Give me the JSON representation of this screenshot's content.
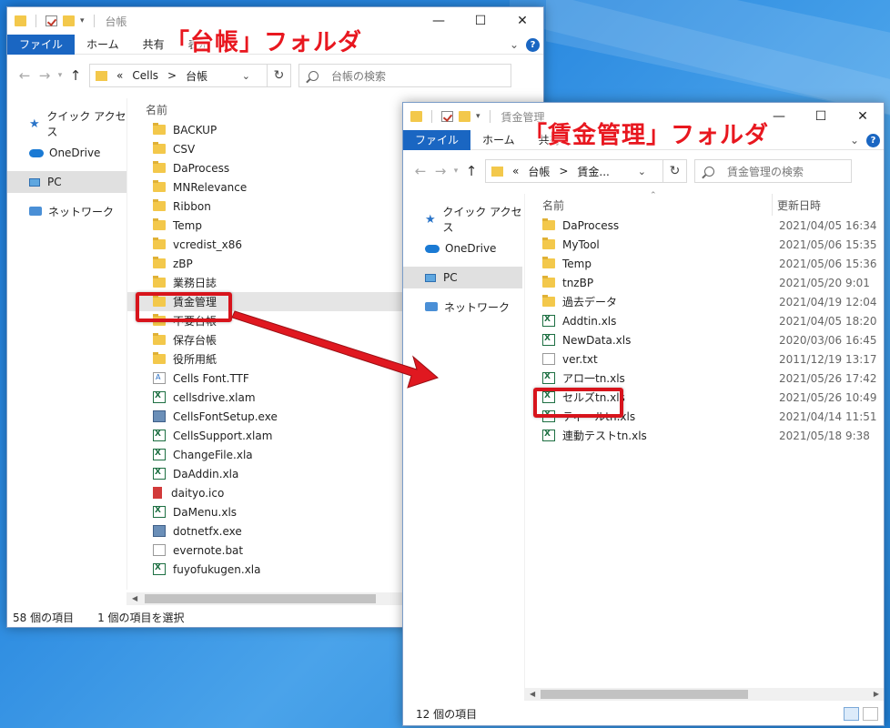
{
  "window1": {
    "title": "台帳",
    "ribbon_tabs": [
      "ファイル",
      "ホーム",
      "共有",
      "表示"
    ],
    "address": {
      "parts": [
        "«",
        "Cells",
        ">",
        "台帳"
      ]
    },
    "search_placeholder": "台帳の検索",
    "nav": [
      "クイック アクセス",
      "OneDrive",
      "PC",
      "ネットワーク"
    ],
    "column_name": "名前",
    "files": [
      {
        "name": "BACKUP",
        "icon": "folder"
      },
      {
        "name": "CSV",
        "icon": "folder"
      },
      {
        "name": "DaProcess",
        "icon": "folder"
      },
      {
        "name": "MNRelevance",
        "icon": "folder"
      },
      {
        "name": "Ribbon",
        "icon": "folder"
      },
      {
        "name": "Temp",
        "icon": "folder"
      },
      {
        "name": "vcredist_x86",
        "icon": "folder"
      },
      {
        "name": "zBP",
        "icon": "folder"
      },
      {
        "name": "業務日誌",
        "icon": "folder"
      },
      {
        "name": "賃金管理",
        "icon": "folder"
      },
      {
        "name": "不要台帳",
        "icon": "folder"
      },
      {
        "name": "保存台帳",
        "icon": "folder"
      },
      {
        "name": "役所用紙",
        "icon": "folder"
      },
      {
        "name": "Cells Font.TTF",
        "icon": "font"
      },
      {
        "name": "cellsdrive.xlam",
        "icon": "excel"
      },
      {
        "name": "CellsFontSetup.exe",
        "icon": "exe"
      },
      {
        "name": "CellsSupport.xlam",
        "icon": "excel"
      },
      {
        "name": "ChangeFile.xla",
        "icon": "excel"
      },
      {
        "name": "DaAddin.xla",
        "icon": "excel"
      },
      {
        "name": "daityo.ico",
        "icon": "ico"
      },
      {
        "name": "DaMenu.xls",
        "icon": "excel"
      },
      {
        "name": "dotnetfx.exe",
        "icon": "exe"
      },
      {
        "name": "evernote.bat",
        "icon": "doc"
      },
      {
        "name": "fuyofukugen.xla",
        "icon": "excel"
      }
    ],
    "status_count": "58 個の項目",
    "status_selected": "1 個の項目を選択"
  },
  "window2": {
    "title": "賃金管理",
    "ribbon_tabs": [
      "ファイル",
      "ホーム",
      "共有"
    ],
    "address": {
      "parts": [
        "«",
        "台帳",
        ">",
        "賃金..."
      ]
    },
    "search_placeholder": "賃金管理の検索",
    "nav": [
      "クイック アクセス",
      "OneDrive",
      "PC",
      "ネットワーク"
    ],
    "column_name": "名前",
    "column_date": "更新日時",
    "files": [
      {
        "name": "DaProcess",
        "date": "2021/04/05 16:34",
        "icon": "folder"
      },
      {
        "name": "MyTool",
        "date": "2021/05/06 15:35",
        "icon": "folder"
      },
      {
        "name": "Temp",
        "date": "2021/05/06 15:36",
        "icon": "folder"
      },
      {
        "name": "tnzBP",
        "date": "2021/05/20 9:01",
        "icon": "folder"
      },
      {
        "name": "過去データ",
        "date": "2021/04/19 12:04",
        "icon": "folder"
      },
      {
        "name": "Addtin.xls",
        "date": "2021/04/05 18:20",
        "icon": "excel"
      },
      {
        "name": "NewData.xls",
        "date": "2020/03/06 16:45",
        "icon": "excel"
      },
      {
        "name": "ver.txt",
        "date": "2011/12/19 13:17",
        "icon": "doc"
      },
      {
        "name": "アロ一tn.xls",
        "date": "2021/05/26 17:42",
        "icon": "excel"
      },
      {
        "name": "セルズtn.xls",
        "date": "2021/05/26 10:49",
        "icon": "excel"
      },
      {
        "name": "ティールtn.xls",
        "date": "2021/04/14 11:51",
        "icon": "excel"
      },
      {
        "name": "連動テストtn.xls",
        "date": "2021/05/18 9:38",
        "icon": "excel"
      }
    ],
    "status_count": "12 個の項目"
  },
  "annotations": {
    "label1": "「台帳」フォルダ",
    "label2": "「賃金管理」フォルダ"
  },
  "colors": {
    "accent": "#1a66c2",
    "highlight": "#d7141c",
    "annotation_text": "#e8171f"
  }
}
